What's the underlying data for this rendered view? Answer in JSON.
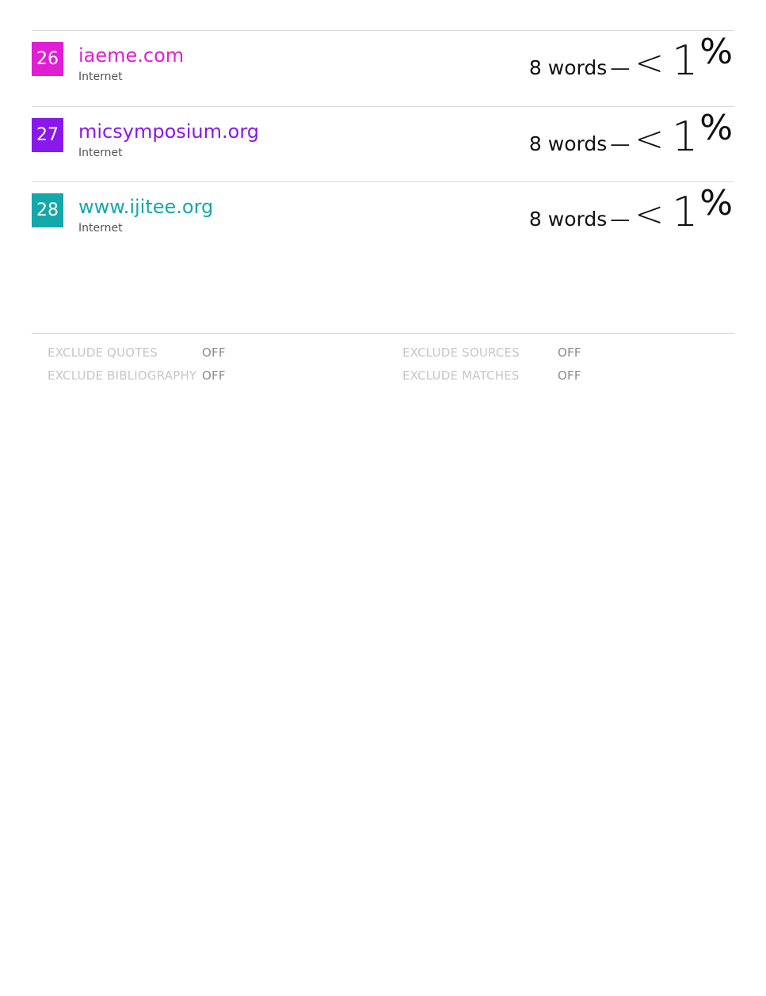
{
  "sources": [
    {
      "number": "26",
      "name": "iaeme.com",
      "type": "Internet",
      "words": "8 words",
      "dash": "—",
      "lt": "<",
      "percent_value": "1",
      "percent_sign": "%",
      "color": "#e01ed3"
    },
    {
      "number": "27",
      "name": "micsymposium.org",
      "type": "Internet",
      "words": "8 words",
      "dash": "—",
      "lt": "<",
      "percent_value": "1",
      "percent_sign": "%",
      "color": "#8a18ea"
    },
    {
      "number": "28",
      "name": "www.ijitee.org",
      "type": "Internet",
      "words": "8 words",
      "dash": "—",
      "lt": "<",
      "percent_value": "1",
      "percent_sign": "%",
      "color": "#13a8aa"
    }
  ],
  "footer": {
    "exclude_quotes_label": "EXCLUDE QUOTES",
    "exclude_quotes_value": "OFF",
    "exclude_bibliography_label": "EXCLUDE BIBLIOGRAPHY",
    "exclude_bibliography_value": "OFF",
    "exclude_sources_label": "EXCLUDE SOURCES",
    "exclude_sources_value": "OFF",
    "exclude_matches_label": "EXCLUDE MATCHES",
    "exclude_matches_value": "OFF"
  }
}
